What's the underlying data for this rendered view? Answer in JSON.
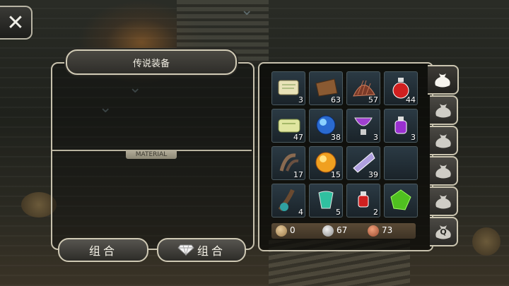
{
  "close_icon": "close-x-icon",
  "title": "传说装备",
  "material_label": "MATERIAL",
  "buttons": {
    "combine": "组合",
    "gem_combine": "组合"
  },
  "inventory": [
    {
      "icon": "scroll",
      "count": "3"
    },
    {
      "icon": "leather",
      "count": "63"
    },
    {
      "icon": "fur",
      "count": "57"
    },
    {
      "icon": "red-potion",
      "count": "44"
    },
    {
      "icon": "green-scroll",
      "count": "47"
    },
    {
      "icon": "blue-orb",
      "count": "38"
    },
    {
      "icon": "purple-chalice",
      "count": "3"
    },
    {
      "icon": "purple-potion",
      "count": "3"
    },
    {
      "icon": "claw",
      "count": "17"
    },
    {
      "icon": "gold-orb",
      "count": "15"
    },
    {
      "icon": "crystal-feather",
      "count": "39"
    },
    {
      "icon": "empty",
      "count": ""
    },
    {
      "icon": "root",
      "count": "4"
    },
    {
      "icon": "teal-flask",
      "count": "5"
    },
    {
      "icon": "small-red-potion",
      "count": "2"
    },
    {
      "icon": "green-gem",
      "count": ""
    }
  ],
  "currency": [
    {
      "name": "bronze-coin",
      "value": "0"
    },
    {
      "name": "silver-coin",
      "value": "67"
    },
    {
      "name": "copper-coin",
      "value": "73"
    }
  ],
  "tabs": [
    {
      "name": "tab-bag-1",
      "label": "",
      "active": true
    },
    {
      "name": "tab-bag-2",
      "label": ""
    },
    {
      "name": "tab-bag-3",
      "label": ""
    },
    {
      "name": "tab-bag-4",
      "label": ""
    },
    {
      "name": "tab-bag-5",
      "label": ""
    },
    {
      "name": "tab-bag-quest",
      "label": "Q"
    }
  ]
}
